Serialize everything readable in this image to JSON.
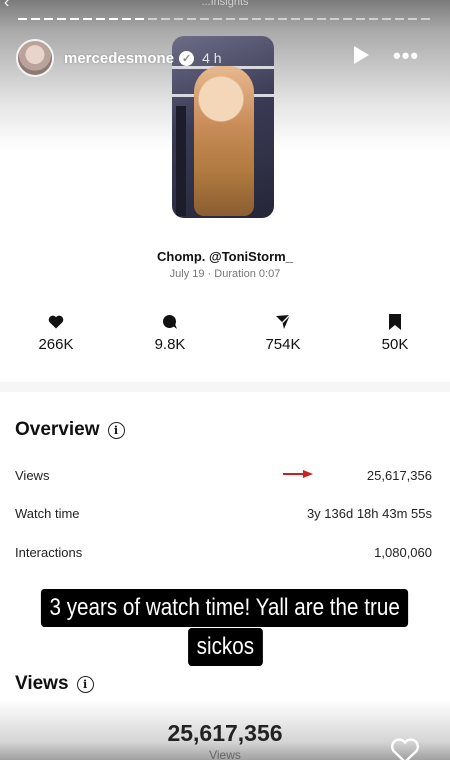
{
  "story": {
    "top_hint": "...Insights",
    "username": "mercedesmone",
    "verified_mark": "✓",
    "time": "4 h",
    "progress_fraction": 0.31
  },
  "post": {
    "caption": "Chomp. @ToniStorm_",
    "meta": "July 19 · Duration 0:07"
  },
  "stats": [
    {
      "icon": "heart-icon",
      "value": "266K"
    },
    {
      "icon": "comment-icon",
      "value": "9.8K"
    },
    {
      "icon": "share-icon",
      "value": "754K"
    },
    {
      "icon": "bookmark-icon",
      "value": "50K"
    }
  ],
  "overview": {
    "title": "Overview",
    "info_glyph": "i",
    "rows": [
      {
        "label": "Views",
        "value": "25,617,356"
      },
      {
        "label": "Watch time",
        "value": "3y 136d 18h 43m 55s"
      },
      {
        "label": "Interactions",
        "value": "1,080,060"
      }
    ]
  },
  "overlay": {
    "line1": "3 years of watch time! Yall are the true",
    "line2": "sickos"
  },
  "views_section": {
    "title": "Views",
    "info_glyph": "i",
    "total": "25,617,356",
    "label": "Views"
  },
  "colors": {
    "arrow": "#cc1f1f",
    "overlay_bg": "#000000"
  }
}
